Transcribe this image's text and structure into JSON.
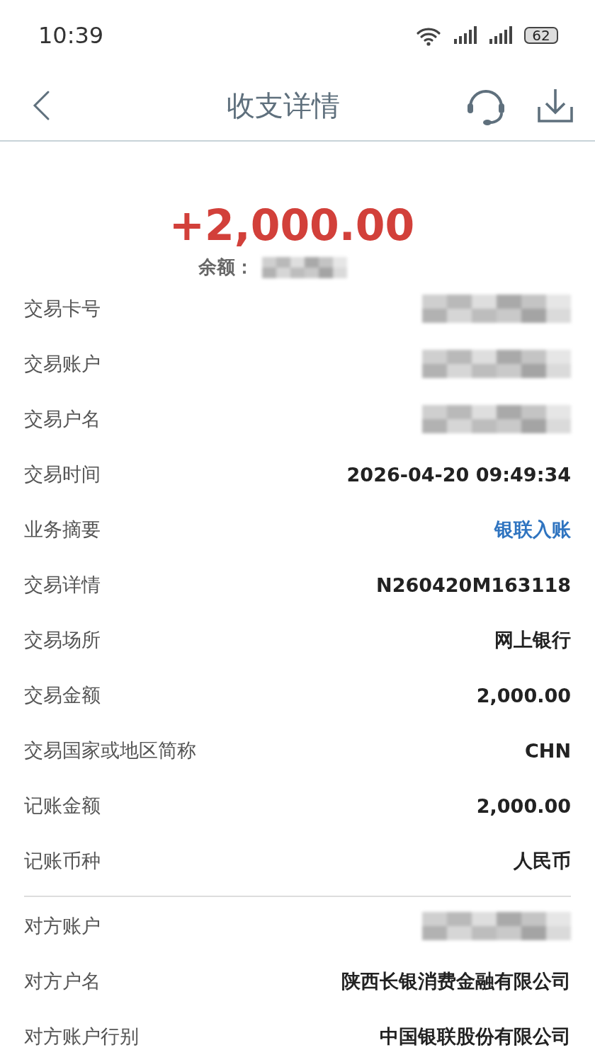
{
  "status_bar": {
    "time": "10:39",
    "battery": "62"
  },
  "header": {
    "title": "收支详情"
  },
  "summary": {
    "amount": "+2,000.00",
    "balance_label": "余额：",
    "balance_redacted": true
  },
  "sections": [
    {
      "rows": [
        {
          "label": "交易卡号",
          "kind": "redacted"
        },
        {
          "label": "交易账户",
          "kind": "redacted"
        },
        {
          "label": "交易户名",
          "kind": "redacted"
        },
        {
          "label": "交易时间",
          "kind": "text",
          "value": "2026-04-20 09:49:34"
        },
        {
          "label": "业务摘要",
          "kind": "link",
          "value": "银联入账"
        },
        {
          "label": "交易详情",
          "kind": "text",
          "value": "N260420M163118"
        },
        {
          "label": "交易场所",
          "kind": "text",
          "value": "网上银行"
        },
        {
          "label": "交易金额",
          "kind": "text",
          "value": "2,000.00"
        },
        {
          "label": "交易国家或地区简称",
          "kind": "text",
          "value": "CHN"
        },
        {
          "label": "记账金额",
          "kind": "text",
          "value": "2,000.00"
        },
        {
          "label": "记账币种",
          "kind": "text",
          "value": "人民币"
        }
      ]
    },
    {
      "rows": [
        {
          "label": "对方账户",
          "kind": "redacted"
        },
        {
          "label": "对方户名",
          "kind": "text",
          "value": "陕西长银消费金融有限公司"
        },
        {
          "label": "对方账户行别",
          "kind": "text",
          "value": "中国银联股份有限公司"
        }
      ]
    }
  ]
}
